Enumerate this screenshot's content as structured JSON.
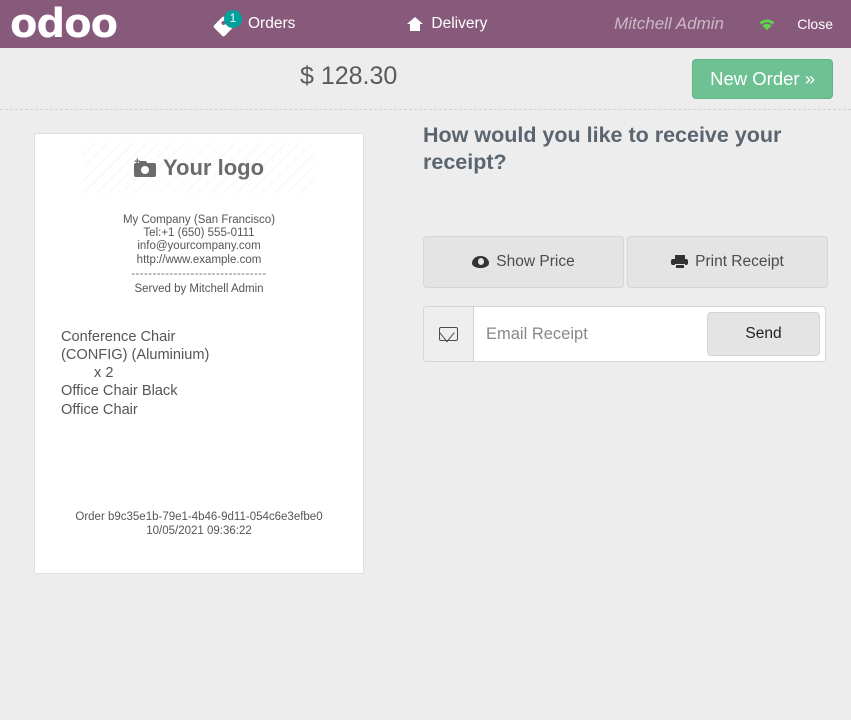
{
  "topbar": {
    "brand": "odoo",
    "orders": {
      "label": "Orders",
      "badge": "1",
      "icon": "tag-icon"
    },
    "delivery": {
      "label": "Delivery",
      "icon": "home-icon"
    },
    "user": "Mitchell Admin",
    "wifi_icon": "wifi-icon",
    "close_label": "Close",
    "bar_color": "#875A7B",
    "badge_color": "#00A09D"
  },
  "subheader": {
    "total": "$ 128.30",
    "new_order_label": "New Order »",
    "new_order_color": "#6DC193"
  },
  "receipt": {
    "logo_placeholder_text": "Your logo",
    "logo_icon": "camera-icon",
    "company": [
      "My Company (San Francisco)",
      "Tel:+1 (650) 555-0111",
      "info@yourcompany.com",
      "http://www.example.com"
    ],
    "separator": "--------------------------------",
    "served_by": "Served by Mitchell Admin",
    "lines": [
      {
        "name": "Conference Chair",
        "detail": "(CONFIG) (Aluminium)",
        "qty": "x 2"
      },
      {
        "name": "Office Chair Black",
        "detail": "",
        "qty": ""
      },
      {
        "name": "Office Chair",
        "detail": "",
        "qty": ""
      }
    ],
    "order_id": "Order b9c35e1b-79e1-4b46-9d11-054c6e3efbe0",
    "timestamp": "10/05/2021 09:36:22"
  },
  "panel": {
    "title": "How would you like to receive your receipt?",
    "show_price_label": "Show Price",
    "show_price_icon": "eye-icon",
    "print_receipt_label": "Print Receipt",
    "print_receipt_icon": "printer-icon",
    "email_icon": "envelope-icon",
    "email_placeholder": "Email Receipt",
    "email_value": "",
    "send_label": "Send"
  }
}
